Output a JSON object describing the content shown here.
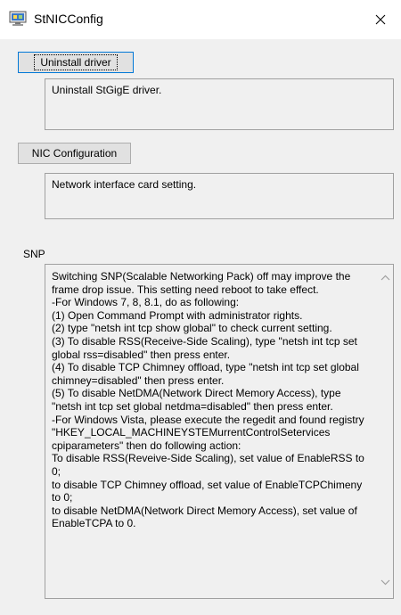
{
  "window": {
    "title": "StNICConfig",
    "app_icon": "network-app-icon",
    "close_icon": "close-icon"
  },
  "uninstall": {
    "button_label": "Uninstall driver",
    "description": "Uninstall StGigE driver."
  },
  "nic": {
    "button_label": "NIC Configuration",
    "description": "Network interface card setting."
  },
  "snp": {
    "group_label": "SNP",
    "text": "Switching SNP(Scalable Networking Pack) off may improve the frame drop issue. This setting need reboot to take effect.\n-For Windows 7, 8, 8.1, do as following:\n(1) Open Command Prompt with administrator rights.\n(2) type \"netsh int tcp show global\" to check current setting.\n(3) To disable RSS(Receive-Side Scaling), type \"netsh int tcp set global rss=disabled\" then press enter.\n(4) To disable TCP Chimney offload, type \"netsh int tcp set global chimney=disabled\" then press enter.\n(5) To disable NetDMA(Network Direct Memory Access), type \"netsh int tcp set global netdma=disabled\" then press enter.\n-For Windows Vista, please execute the regedit and found registry \"HKEY_LOCAL_MACHINEYSTEMurrentControlSetervices cpiparameters\" then do following action:\nTo disable RSS(Reveive-Side Scaling), set value of EnableRSS to 0;\nto disable TCP Chimney offload, set value of EnableTCPChimeny to 0;\nto disable NetDMA(Network Direct Memory Access), set value of EnableTCPA to 0."
  }
}
